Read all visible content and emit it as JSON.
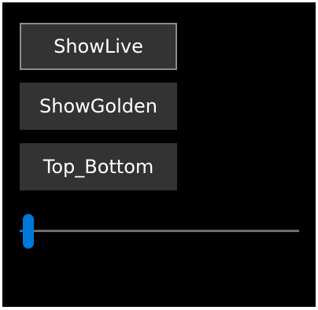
{
  "buttons": {
    "show_live": "ShowLive",
    "show_golden": "ShowGolden",
    "top_bottom": "Top_Bottom"
  },
  "slider": {
    "value_fraction": 0.03,
    "accent_color": "#0078d7",
    "track_color": "#6e6e6e"
  },
  "colors": {
    "background": "#000000",
    "button_bg": "#333333",
    "button_text": "#ffffff",
    "focus_border": "#8c8c8c"
  }
}
